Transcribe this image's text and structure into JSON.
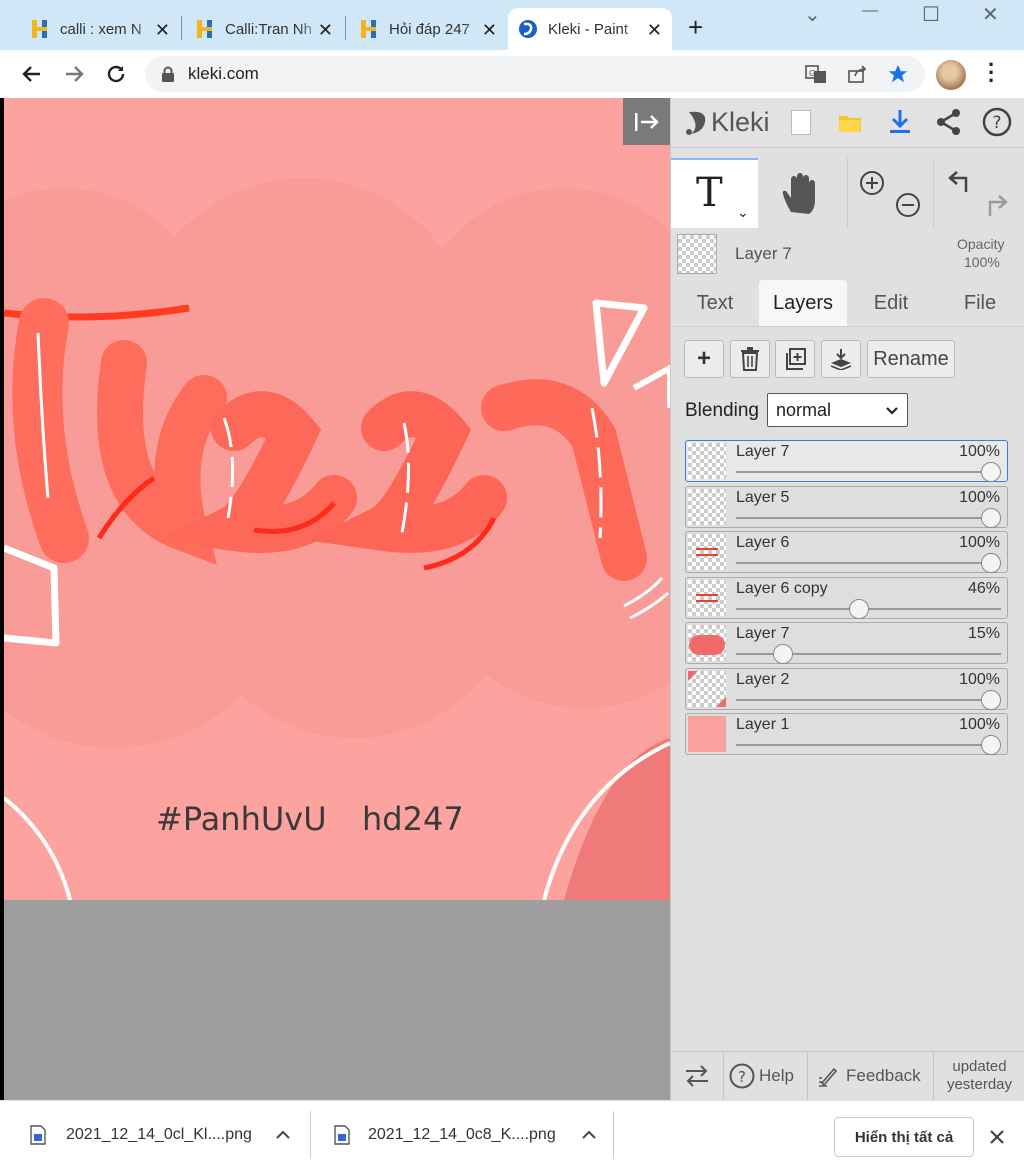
{
  "browser": {
    "tabs": [
      {
        "title": "calli : xem N",
        "favicon": "hoidap-H-icon"
      },
      {
        "title": "Calli:Tran Nh",
        "favicon": "hoidap-H-icon"
      },
      {
        "title": "Hỏi đáp 247",
        "favicon": "hoidap-H-icon"
      },
      {
        "title": "Kleki - Paint",
        "favicon": "kleki-icon",
        "active": true
      }
    ],
    "new_tab": "+",
    "window_controls": {
      "dropdown": "⌄",
      "minimize": "—",
      "maximize": "☐",
      "close": "✕"
    },
    "url": "kleki.com"
  },
  "canvas": {
    "artwork_text": "Tran",
    "hashtag_1": "#PanhUvU",
    "hashtag_2": "hd247"
  },
  "kleki": {
    "logo": "Kleki",
    "tool_text": "T",
    "layer_header": {
      "name": "Layer 7",
      "opacity_label": "Opacity",
      "opacity_value": "100%"
    },
    "tabs": [
      "Text",
      "Layers",
      "Edit",
      "File"
    ],
    "active_tab": "Layers",
    "rename_label": "Rename",
    "blending_label": "Blending",
    "blending_value": "normal",
    "layers": [
      {
        "name": "Layer 7",
        "opacity": "100%",
        "level": 1.0,
        "thumb": "empty"
      },
      {
        "name": "Layer 5",
        "opacity": "100%",
        "level": 1.0,
        "thumb": "empty"
      },
      {
        "name": "Layer 6",
        "opacity": "100%",
        "level": 1.0,
        "thumb": "text"
      },
      {
        "name": "Layer 6 copy",
        "opacity": "46%",
        "level": 0.46,
        "thumb": "text"
      },
      {
        "name": "Layer 7",
        "opacity": "15%",
        "level": 0.15,
        "thumb": "blob"
      },
      {
        "name": "Layer 2",
        "opacity": "100%",
        "level": 1.0,
        "thumb": "corner"
      },
      {
        "name": "Layer 1",
        "opacity": "100%",
        "level": 1.0,
        "thumb": "fill"
      }
    ],
    "footer": {
      "help": "Help",
      "feedback": "Feedback",
      "updated_1": "updated",
      "updated_2": "yesterday"
    }
  },
  "downloads": {
    "items": [
      "2021_12_14_0cl_Kl....png",
      "2021_12_14_0c8_K....png"
    ],
    "show_all": "Hiển thị tất cả"
  },
  "colors": {
    "canvas_bg": "#fca3a0",
    "accent_blue": "#1a73e8",
    "layer1_fill": "#f9a19d"
  }
}
